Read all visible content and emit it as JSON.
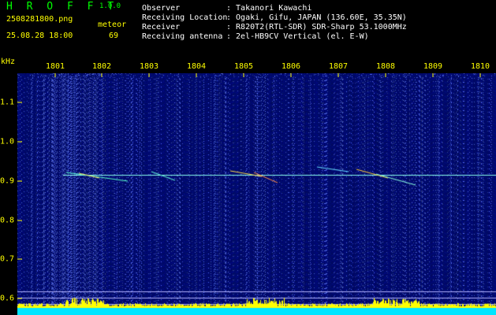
{
  "header": {
    "app_title": "H R O F F T",
    "app_version": "1.0.0",
    "filename": "25082818​00.png",
    "detection_type": "meteor",
    "timestamp": "25.08.28 18:00",
    "count": "69"
  },
  "info": [
    {
      "label": "Observer",
      "value": ": Takanori Kawachi"
    },
    {
      "label": "Receiving Location",
      "value": ": Ogaki, Gifu, JAPAN (136.60E, 35.35N)"
    },
    {
      "label": "Receiver",
      "value": ": R820T2(RTL-SDR) SDR-Sharp 53.1000MHz"
    },
    {
      "label": "Receiving antenna",
      "value": ": 2el-HB9CV Vertical (el. E-W)"
    }
  ],
  "axis": {
    "unit": "kHz",
    "time_labels": [
      "1801",
      "1802",
      "1803",
      "1804",
      "1805",
      "1806",
      "1807",
      "1808",
      "1809",
      "1810"
    ],
    "freq_labels": [
      "1.1",
      "1.0",
      "0.9",
      "0.8",
      "0.7",
      "0.6"
    ]
  },
  "colors": {
    "text_yellow": "#ffff00",
    "title_green": "#00ff00",
    "spectro_bg": "#000a6e",
    "carrier": "#88ffee",
    "bottom_band": "#00e5ff"
  }
}
